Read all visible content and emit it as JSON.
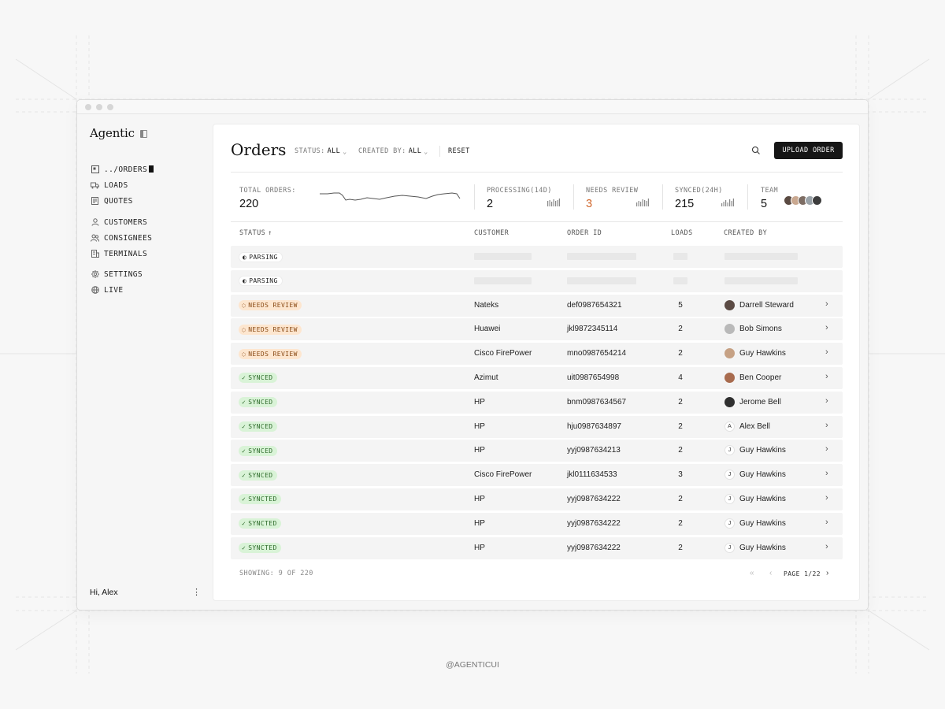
{
  "app": {
    "logo": "Agentic",
    "greeting": "Hi, Alex",
    "handle": "@AGENTICUI"
  },
  "sidebar": {
    "items": [
      {
        "label": "../ORDERS",
        "icon": "orders-icon"
      },
      {
        "label": "LOADS",
        "icon": "truck-icon"
      },
      {
        "label": "QUOTES",
        "icon": "document-icon"
      },
      {
        "label": "CUSTOMERS",
        "icon": "user-icon"
      },
      {
        "label": "CONSIGNEES",
        "icon": "users-icon"
      },
      {
        "label": "TERMINALS",
        "icon": "building-icon"
      },
      {
        "label": "SETTINGS",
        "icon": "gear-icon"
      },
      {
        "label": "LIVE",
        "icon": "globe-icon"
      }
    ]
  },
  "header": {
    "title": "Orders",
    "status_filter": {
      "label": "STATUS:",
      "value": "ALL"
    },
    "created_filter": {
      "label": "CREATED BY:",
      "value": "ALL"
    },
    "reset": "RESET",
    "upload": "UPLOAD ORDER"
  },
  "stats": {
    "total": {
      "label": "TOTAL ORDERS:",
      "value": "220"
    },
    "processing": {
      "label": "PROCESSING(14D)",
      "value": "2"
    },
    "review": {
      "label": "NEEDS REVIEW",
      "value": "3"
    },
    "synced": {
      "label": "SYNCED(24H)",
      "value": "215"
    },
    "team": {
      "label": "TEAM",
      "value": "5"
    }
  },
  "colors": {
    "accent_orange": "#d0662a",
    "review_bg": "#fde6cf",
    "synced_bg": "#d9f3d7",
    "button_dark": "#161616"
  },
  "table": {
    "columns": [
      "STATUS",
      "CUSTOMER",
      "ORDER ID",
      "LOADS",
      "CREATED BY"
    ],
    "rows": [
      {
        "status": "PARSING",
        "kind": "parsing",
        "customer": "",
        "order_id": "",
        "loads": "",
        "created_by": "",
        "avatar": ""
      },
      {
        "status": "PARSING",
        "kind": "parsing",
        "customer": "",
        "order_id": "",
        "loads": "",
        "created_by": "",
        "avatar": ""
      },
      {
        "status": "NEEDS REVIEW",
        "kind": "review",
        "customer": "Nateks",
        "order_id": "def0987654321",
        "loads": "5",
        "created_by": "Darrell Steward",
        "avatar": "photo"
      },
      {
        "status": "NEEDS REVIEW",
        "kind": "review",
        "customer": "Huawei",
        "order_id": "jkl9872345114",
        "loads": "2",
        "created_by": "Bob Simons",
        "avatar": "photo"
      },
      {
        "status": "NEEDS REVIEW",
        "kind": "review",
        "customer": "Cisco FirePower",
        "order_id": "mno0987654214",
        "loads": "2",
        "created_by": "Guy Hawkins",
        "avatar": "photo"
      },
      {
        "status": "SYNCED",
        "kind": "synced",
        "customer": "Azimut",
        "order_id": "uit0987654998",
        "loads": "4",
        "created_by": "Ben Cooper",
        "avatar": "photo"
      },
      {
        "status": "SYNCED",
        "kind": "synced",
        "customer": "HP",
        "order_id": "bnm0987634567",
        "loads": "2",
        "created_by": "Jerome Bell",
        "avatar": "photo"
      },
      {
        "status": "SYNCED",
        "kind": "synced",
        "customer": "HP",
        "order_id": "hju0987634897",
        "loads": "2",
        "created_by": "Alex Bell",
        "avatar": "A"
      },
      {
        "status": "SYNCED",
        "kind": "synced",
        "customer": "HP",
        "order_id": "yyj0987634213",
        "loads": "2",
        "created_by": "Guy Hawkins",
        "avatar": "J"
      },
      {
        "status": "SYNCED",
        "kind": "synced",
        "customer": "Cisco FirePower",
        "order_id": "jkl0111634533",
        "loads": "3",
        "created_by": "Guy Hawkins",
        "avatar": "J"
      },
      {
        "status": "SYNCTED",
        "kind": "synced",
        "customer": "HP",
        "order_id": "yyj0987634222",
        "loads": "2",
        "created_by": "Guy Hawkins",
        "avatar": "J"
      },
      {
        "status": "SYNCTED",
        "kind": "synced",
        "customer": "HP",
        "order_id": "yyj0987634222",
        "loads": "2",
        "created_by": "Guy Hawkins",
        "avatar": "J"
      },
      {
        "status": "SYNCTED",
        "kind": "synced",
        "customer": "HP",
        "order_id": "yyj0987634222",
        "loads": "2",
        "created_by": "Guy Hawkins",
        "avatar": "J"
      }
    ]
  },
  "footer": {
    "showing": "SHOWING: 9 OF 220",
    "page": "PAGE 1/22"
  }
}
